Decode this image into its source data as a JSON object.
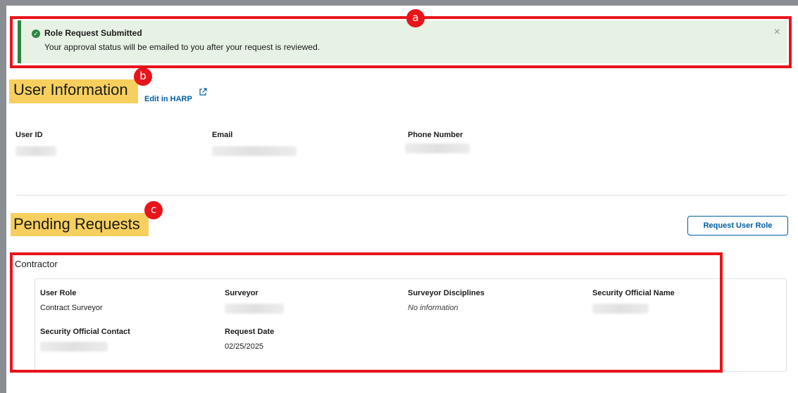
{
  "alert": {
    "title": "Role Request Submitted",
    "message": "Your approval status will be emailed to you after your request is reviewed.",
    "close_label": "×",
    "color": "#2e8540"
  },
  "annotations": [
    "a",
    "b",
    "c"
  ],
  "user_info": {
    "title": "User Information",
    "edit_link": "Edit in HARP",
    "fields": [
      {
        "label": "User ID"
      },
      {
        "label": "Email"
      },
      {
        "label": "Phone Number"
      }
    ]
  },
  "pending": {
    "title": "Pending Requests",
    "request_button": "Request User Role",
    "group_title": "Contractor",
    "fields": {
      "user_role": {
        "label": "User Role",
        "value": "Contract Surveyor"
      },
      "surveyor": {
        "label": "Surveyor"
      },
      "disciplines": {
        "label": "Surveyor Disciplines",
        "value": "No information"
      },
      "security_name": {
        "label": "Security Official Name"
      },
      "security_contact": {
        "label": "Security Official Contact"
      },
      "request_date": {
        "label": "Request Date",
        "value": "02/25/2025"
      }
    }
  },
  "colors": {
    "link": "#005ea2",
    "annotation": "#e8141b",
    "highlight": "#f7cf5f",
    "frame": "#8a8e93"
  }
}
